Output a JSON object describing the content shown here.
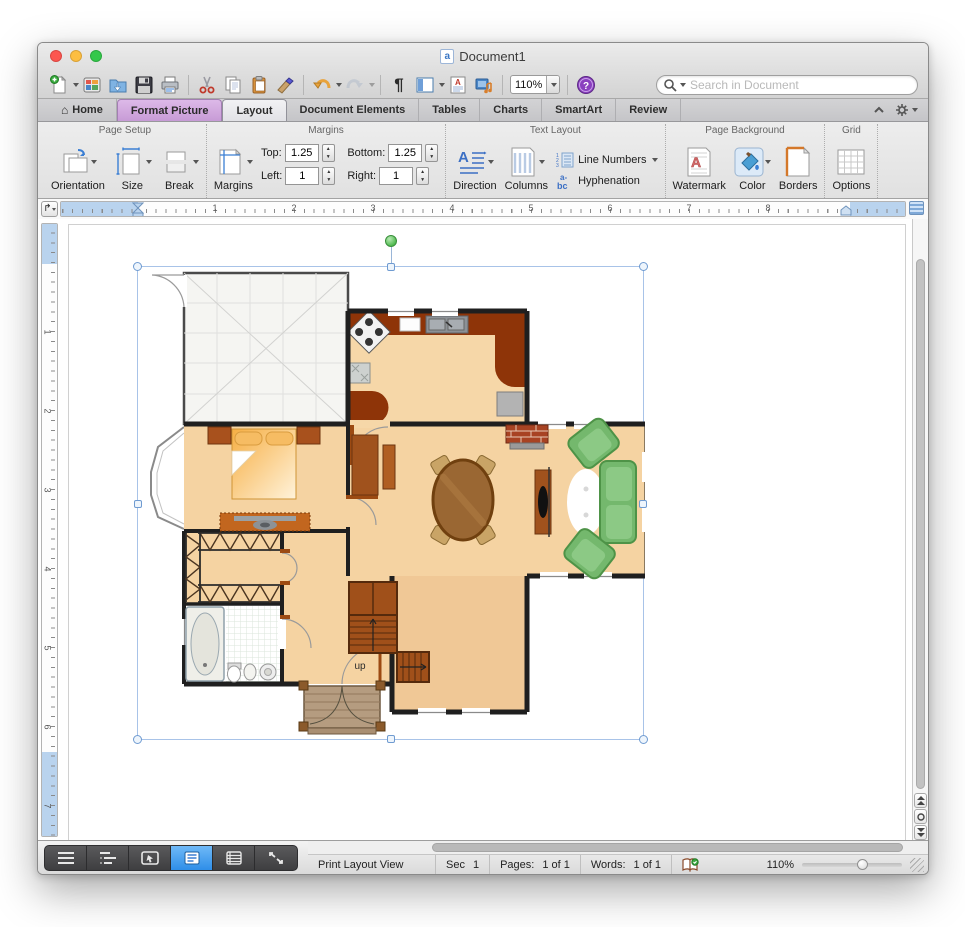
{
  "window": {
    "title": "Document1"
  },
  "toolbar": {
    "zoom": "110%",
    "search_placeholder": "Search in Document"
  },
  "tabs": [
    {
      "label": "Home"
    },
    {
      "label": "Format Picture"
    },
    {
      "label": "Layout"
    },
    {
      "label": "Document Elements"
    },
    {
      "label": "Tables"
    },
    {
      "label": "Charts"
    },
    {
      "label": "SmartArt"
    },
    {
      "label": "Review"
    }
  ],
  "ribbon": {
    "groups": {
      "page_setup": {
        "label": "Page Setup",
        "orientation": "Orientation",
        "size": "Size",
        "break": "Break"
      },
      "margins": {
        "label": "Margins",
        "button": "Margins",
        "top_label": "Top:",
        "top_value": "1.25",
        "bottom_label": "Bottom:",
        "bottom_value": "1.25",
        "left_label": "Left:",
        "left_value": "1",
        "right_label": "Right:",
        "right_value": "1"
      },
      "text_layout": {
        "label": "Text Layout",
        "direction": "Direction",
        "columns": "Columns",
        "line_numbers": "Line Numbers",
        "hyphenation": "Hyphenation"
      },
      "page_background": {
        "label": "Page Background",
        "watermark": "Watermark",
        "color": "Color",
        "borders": "Borders"
      },
      "grid": {
        "label": "Grid",
        "options": "Options"
      }
    }
  },
  "ruler": {
    "h": [
      "1",
      "2",
      "3",
      "4",
      "5",
      "6",
      "7",
      "8"
    ],
    "v": [
      "1",
      "2",
      "3",
      "4",
      "5",
      "6",
      "7"
    ]
  },
  "document": {
    "floorplan_up_label": "up"
  },
  "status": {
    "view": "Print Layout View",
    "sec_label": "Sec",
    "sec_value": "1",
    "pages_label": "Pages:",
    "pages_value": "1 of 1",
    "words_label": "Words:",
    "words_value": "1 of 1",
    "zoom": "110%"
  },
  "colors": {
    "selection": "#6f9bd1",
    "contextual_tab": "#c79bd6",
    "active_view_button": "#2e8ee8",
    "floor_tan": "#f5d3a2",
    "counter_rust": "#8e3408",
    "sofa_green": "#74b86d"
  }
}
